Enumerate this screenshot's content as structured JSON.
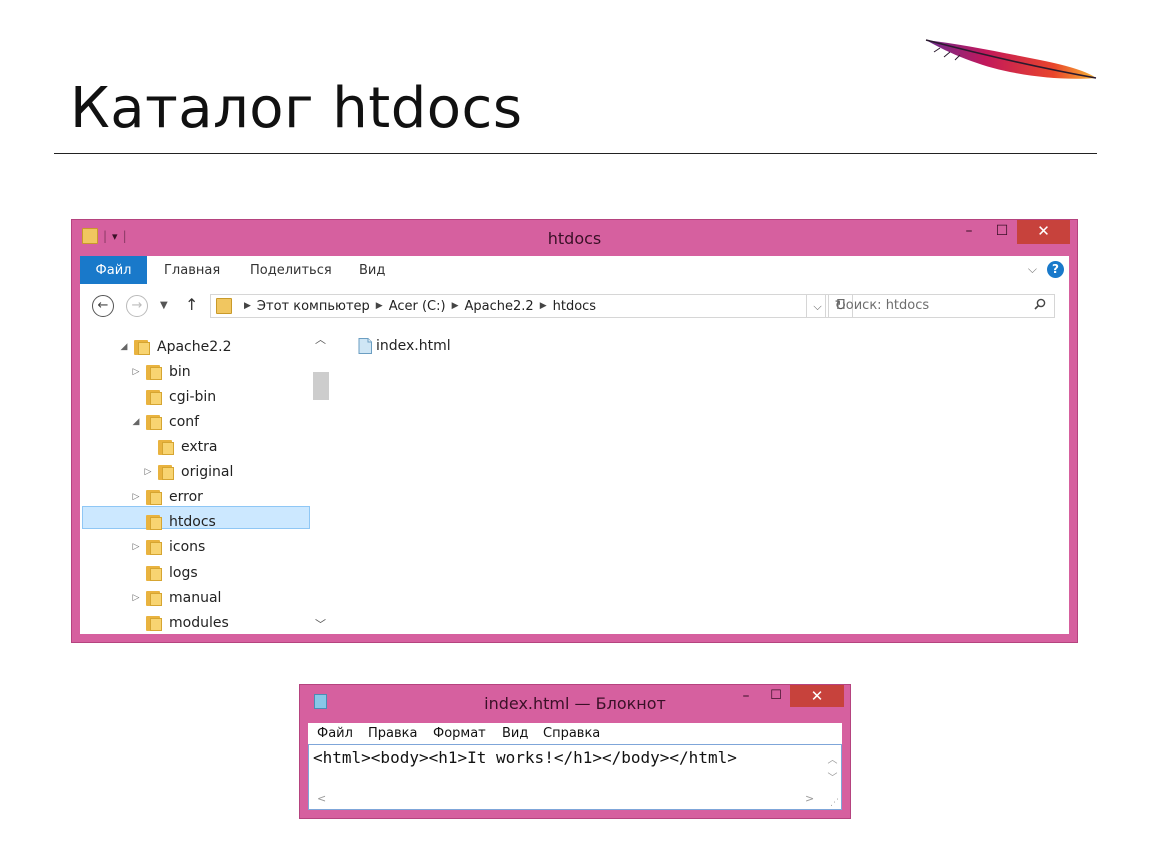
{
  "slide": {
    "title": "Каталог htdocs"
  },
  "explorer": {
    "window_title": "htdocs",
    "controls": {
      "minimize": "–",
      "maximize": "☐",
      "close": "✕"
    },
    "ribbon": {
      "file": "Файл",
      "home": "Главная",
      "share": "Поделиться",
      "view": "Вид",
      "help": "?"
    },
    "address": {
      "crumbs": [
        "Этот компьютер",
        "Acer (C:)",
        "Apache2.2",
        "htdocs"
      ],
      "search_placeholder": "Поиск: htdocs"
    },
    "tree": [
      {
        "label": "Apache2.2",
        "arrow": "◢",
        "level": 0
      },
      {
        "label": "bin",
        "arrow": "▷",
        "level": 1
      },
      {
        "label": "cgi-bin",
        "arrow": "",
        "level": 1
      },
      {
        "label": "conf",
        "arrow": "◢",
        "level": 1
      },
      {
        "label": "extra",
        "arrow": "",
        "level": 2
      },
      {
        "label": "original",
        "arrow": "▷",
        "level": 2
      },
      {
        "label": "error",
        "arrow": "▷",
        "level": 1
      },
      {
        "label": "htdocs",
        "arrow": "",
        "level": 1,
        "selected": true
      },
      {
        "label": "icons",
        "arrow": "▷",
        "level": 1
      },
      {
        "label": "logs",
        "arrow": "",
        "level": 1
      },
      {
        "label": "manual",
        "arrow": "▷",
        "level": 1
      },
      {
        "label": "modules",
        "arrow": "",
        "level": 1
      }
    ],
    "files": [
      {
        "name": "index.html"
      }
    ]
  },
  "notepad": {
    "window_title": "index.html — Блокнот",
    "controls": {
      "minimize": "–",
      "maximize": "☐",
      "close": "✕"
    },
    "menu": [
      "Файл",
      "Правка",
      "Формат",
      "Вид",
      "Справка"
    ],
    "text": "<html><body><h1>It works!</h1></body></html>"
  },
  "colors": {
    "window_frame": "#d6609f",
    "close_button": "#c7423c",
    "accent_blue": "#1979ca",
    "selection": "#cce8ff"
  }
}
